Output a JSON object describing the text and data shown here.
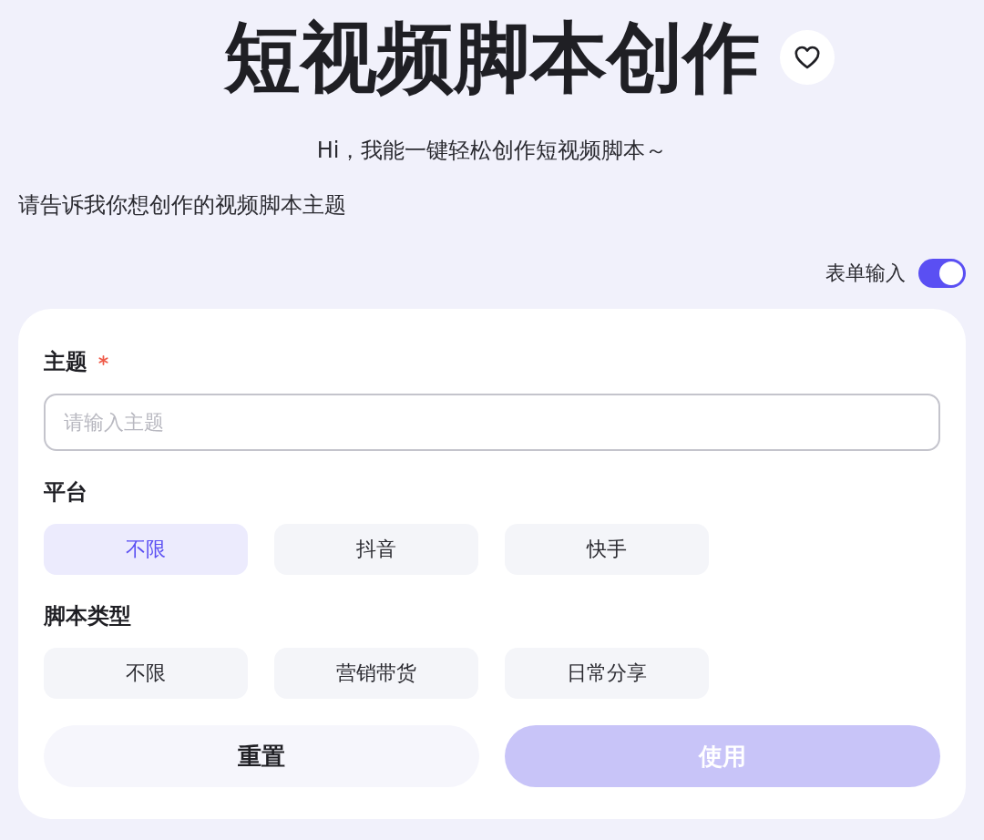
{
  "header": {
    "title": "短视频脚本创作",
    "favorited": false
  },
  "greeting": "Hi，我能一键轻松创作短视频脚本～",
  "prompt": "请告诉我你想创作的视频脚本主题",
  "form_toggle": {
    "label": "表单输入",
    "on": true
  },
  "form": {
    "fields": [
      {
        "kind": "text",
        "label": "主题",
        "required": true,
        "placeholder": "请输入主题"
      },
      {
        "kind": "choices",
        "label": "平台",
        "required": false,
        "options": [
          {
            "label": "不限",
            "selected": true
          },
          {
            "label": "抖音",
            "selected": false
          },
          {
            "label": "快手",
            "selected": false
          }
        ]
      },
      {
        "kind": "choices",
        "label": "脚本类型",
        "required": false,
        "options": [
          {
            "label": "不限",
            "selected": false
          },
          {
            "label": "营销带货",
            "selected": false
          },
          {
            "label": "日常分享",
            "selected": false
          }
        ]
      }
    ],
    "buttons": [
      {
        "label": "重置",
        "kind": "secondary",
        "disabled": false
      },
      {
        "label": "使用",
        "kind": "primary",
        "disabled": true
      }
    ]
  }
}
